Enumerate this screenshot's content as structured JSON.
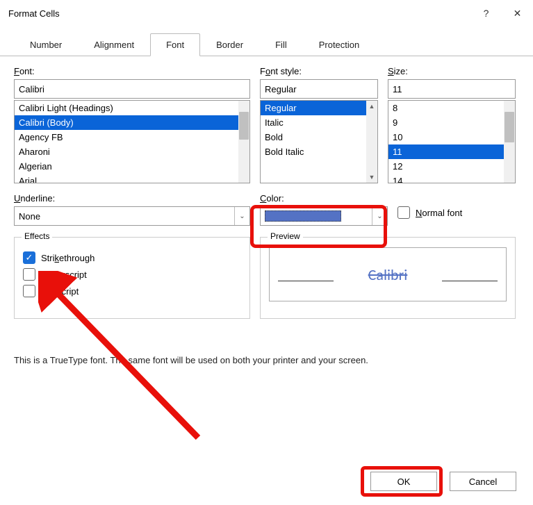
{
  "title": "Format Cells",
  "help_glyph": "?",
  "close_glyph": "✕",
  "tabs": [
    "Number",
    "Alignment",
    "Font",
    "Border",
    "Fill",
    "Protection"
  ],
  "active_tab": 2,
  "font": {
    "label_html": "Font:",
    "input": "Calibri",
    "list": [
      "Calibri Light (Headings)",
      "Calibri (Body)",
      "Agency FB",
      "Aharoni",
      "Algerian",
      "Arial"
    ],
    "selected_index": 1
  },
  "style": {
    "label_html": "Font style:",
    "input": "Regular",
    "list": [
      "Regular",
      "Italic",
      "Bold",
      "Bold Italic"
    ],
    "selected_index": 0
  },
  "size": {
    "label_html": "Size:",
    "input": "11",
    "list": [
      "8",
      "9",
      "10",
      "11",
      "12",
      "14"
    ],
    "selected_index": 3
  },
  "underline": {
    "label_html": "Underline:",
    "value": "None"
  },
  "color": {
    "label_html": "Color:",
    "swatch_hex": "#5472c4"
  },
  "normal_font": {
    "label_html": "Normal font",
    "checked": false
  },
  "effects": {
    "legend": "Effects",
    "strikethrough": {
      "label_html": "Strikethrough",
      "checked": true
    },
    "superscript": {
      "label_html": "Superscript",
      "checked": false
    },
    "subscript": {
      "label_html": "Subscript",
      "checked": false
    }
  },
  "preview": {
    "legend": "Preview",
    "text": "Calibri"
  },
  "note": "This is a TrueType font.  The same font will be used on both your printer and your screen.",
  "buttons": {
    "ok": "OK",
    "cancel": "Cancel"
  }
}
